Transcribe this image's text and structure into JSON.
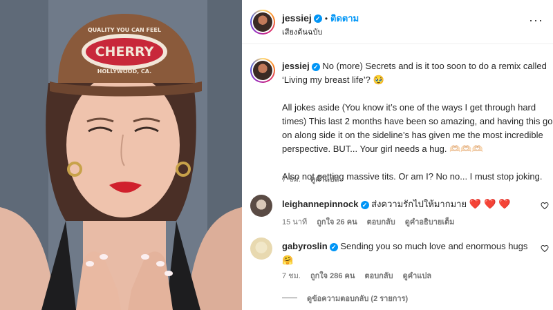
{
  "post": {
    "author": "jessiej",
    "follow_label": "ติดตาม",
    "dot": "•",
    "audio_label": "เสียงต้นฉบับ",
    "more_label": "···",
    "caption_line1": "No (more) Secrets and is it too soon to do a remix called",
    "caption_line2": "‘Living my breast life’? 🥹",
    "caption_p2_l1": "All jokes aside (You know it’s one of the ways I get through hard",
    "caption_p2_l2": "times) This last 2 months have been so amazing, and having this go",
    "caption_p2_l3": "on along side it on the sideline’s has given me the most incredible",
    "caption_p2_l4": "perspective. BUT... Your girl needs a hug. 🫶🏻🫶🏻🫶🏻",
    "caption_p3": "Also not getting massive tits. Or am I? No no... I must stop joking.",
    "time": "7 ชม.",
    "translate": "ดูคำแปล"
  },
  "cap": {
    "line_top": "QUALITY YOU CAN FEEL",
    "brand": "CHERRY",
    "line_bottom": "HOLLYWOOD, CA."
  },
  "comments": [
    {
      "user": "leighannepinnock",
      "text": "ส่งความรักไปให้มากมาย",
      "hearts": "❤️ ❤️ ❤️",
      "time": "15 นาที",
      "likes": "ถูกใจ 26 คน",
      "reply": "ตอบกลับ",
      "extra": "ดูคำอธิบายเต็ม"
    },
    {
      "user": "gabyroslin",
      "text": "Sending you so much love and enormous hugs",
      "emoji": "🤗",
      "time": "7 ชม.",
      "likes": "ถูกใจ 286 คน",
      "reply": "ตอบกลับ",
      "extra": "ดูคำแปล"
    }
  ],
  "view_replies": "ดูข้อความตอบกลับ (2 รายการ)",
  "colors": {
    "link_blue": "#0095f6",
    "verified_blue": "#0095f6",
    "heart_red": "#e0245e",
    "cap_brown": "#8a5a3b",
    "cap_red": "#c8283a"
  },
  "icons": {
    "verified": "verified-badge-icon",
    "more": "more-options-icon",
    "like": "heart-outline-icon"
  }
}
